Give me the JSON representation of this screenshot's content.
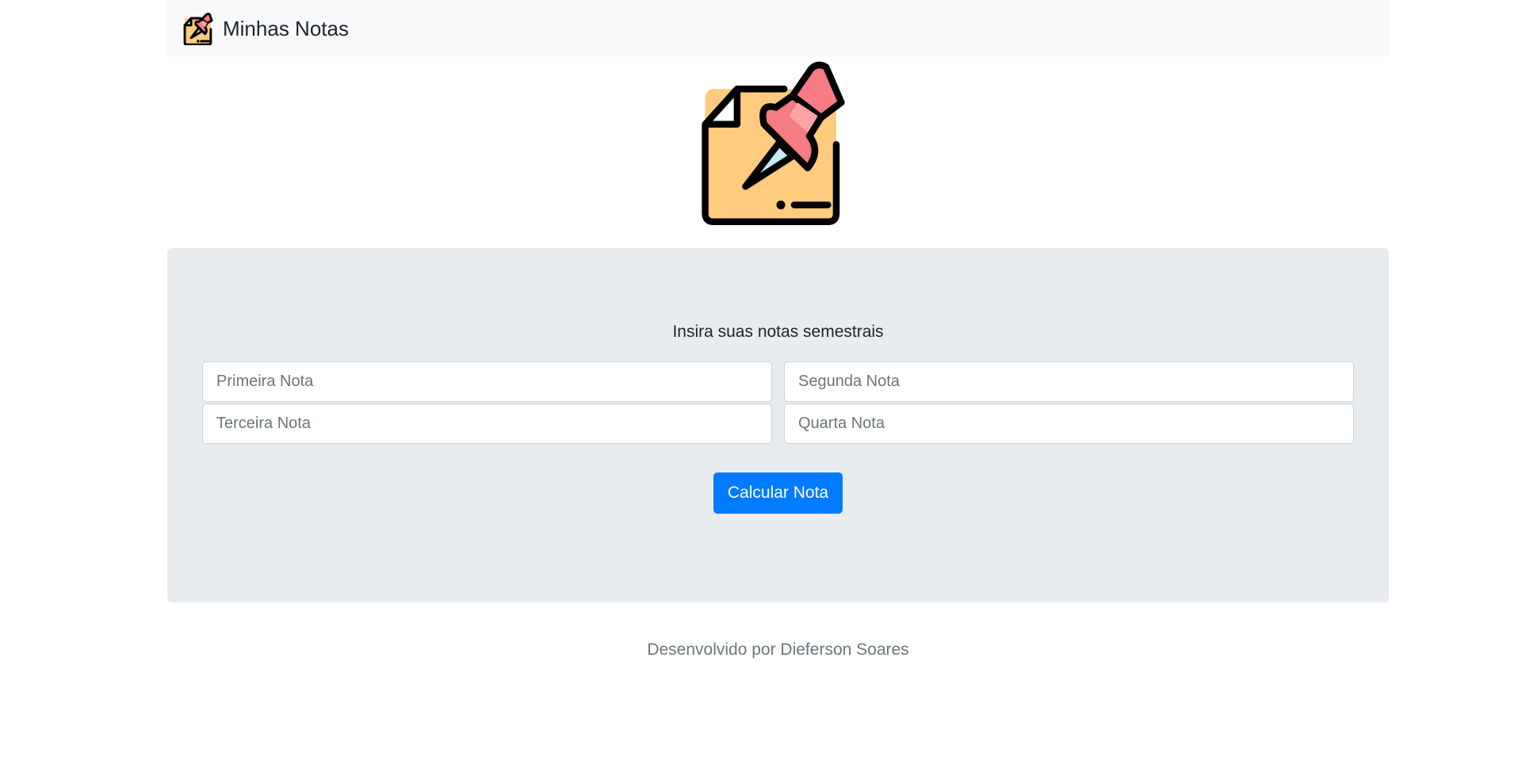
{
  "navbar": {
    "brand_text": "Minhas Notas",
    "logo_icon": "note-pin-icon"
  },
  "hero": {
    "logo_icon": "note-pin-icon"
  },
  "form": {
    "title": "Insira suas notas semestrais",
    "inputs": [
      {
        "placeholder": "Primeira Nota",
        "value": ""
      },
      {
        "placeholder": "Segunda Nota",
        "value": ""
      },
      {
        "placeholder": "Terceira Nota",
        "value": ""
      },
      {
        "placeholder": "Quarta Nota",
        "value": ""
      }
    ],
    "submit_label": "Calcular Nota"
  },
  "footer": {
    "text": "Desenvolvido por Dieferson Soares"
  },
  "colors": {
    "navbar_bg": "#f8f9fa",
    "jumbotron_bg": "#e9ecef",
    "primary": "#007bff",
    "note_yellow": "#fecb7f",
    "pin_red": "#f77b83",
    "pin_light": "#fca3a6",
    "needle_blue": "#c6ebf5"
  }
}
